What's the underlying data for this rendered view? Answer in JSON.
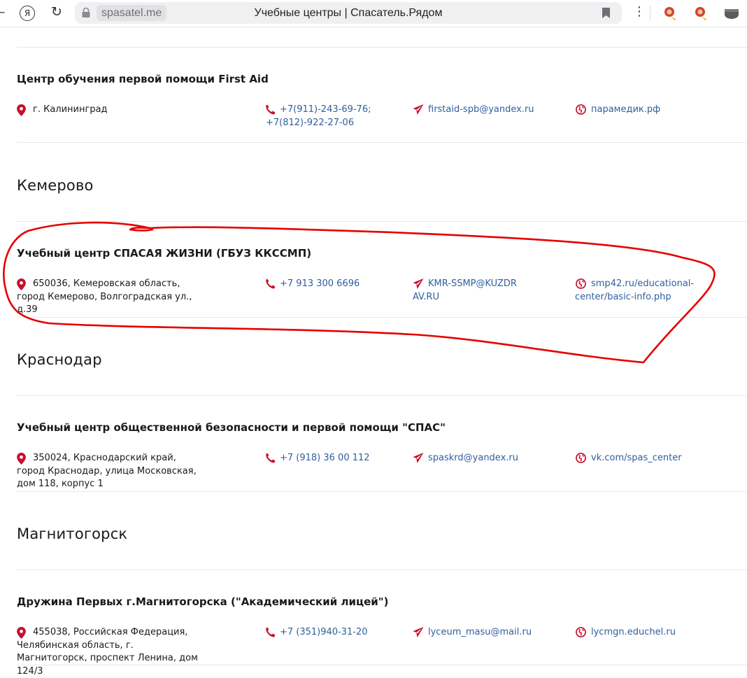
{
  "browser": {
    "domain": "spasatel.me",
    "tab_title": "Учебные центры | Спасатель.Рядом",
    "yandex_label": "Я",
    "menu_label": "⋮",
    "back_label": "←",
    "reload_label": "↻"
  },
  "colors": {
    "accent": "#c8102e",
    "link": "#2f5f9e",
    "annotation": "#e60000"
  },
  "entries": [
    {
      "org": "Центр обучения первой помощи First Aid",
      "address": "г. Калининград",
      "phone": "+7(911)-243-69-76; +7(812)-922-27-06",
      "email": "firstaid-spb@yandex.ru",
      "site": "парамедик.рф"
    },
    {
      "city": "Кемерово",
      "org": "Учебный центр СПАСАЯ ЖИЗНИ (ГБУЗ ККССМП)",
      "address": "650036, Кемеровская область, город Кемерово, Волгоградская ул., д.39",
      "phone": "+7 913 300 6696",
      "email": "KMR-SSMP@KUZDRAV.RU",
      "site": "smp42.ru/educational-center/basic-info.php"
    },
    {
      "city": "Краснодар",
      "org": "Учебный центр общественной безопасности и первой помощи \"СПАС\"",
      "address": "350024, Краснодарский край, город Краснодар, улица Московская, дом 118, корпус 1",
      "phone": "+7 (918) 36 00 112",
      "email": "spaskrd@yandex.ru",
      "site": "vk.com/spas_center"
    },
    {
      "city": "Магнитогорск",
      "org": "Дружина Первых г.Магнитогорска (\"Академический лицей\")",
      "address": "455038, Российская Федерация, Челябинская область, г. Магнитогорск, проспект Ленина, дом 124/3",
      "phone": "+7 (351)940-31-20",
      "email": "lyceum_masu@mail.ru",
      "site": "lycmgn.educhel.ru"
    }
  ]
}
